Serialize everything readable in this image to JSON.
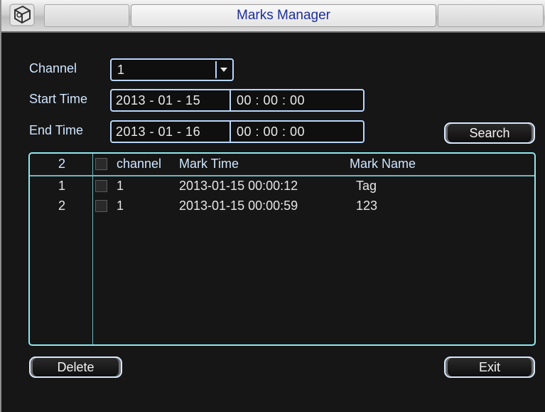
{
  "window": {
    "title": "Marks Manager"
  },
  "form": {
    "channel_label": "Channel",
    "channel_value": "1",
    "start_label": "Start Time",
    "start_date": "2013  - 01 - 15",
    "start_time": "00 : 00 : 00",
    "end_label": "End Time",
    "end_date": "2013  - 01 - 16",
    "end_time": "00 : 00 : 00",
    "search_label": "Search"
  },
  "table": {
    "count": "2",
    "headers": {
      "channel": "channel",
      "mark_time": "Mark Time",
      "mark_name": "Mark Name"
    },
    "rows": [
      {
        "index": "1",
        "channel": "1",
        "mark_time": "2013-01-15 00:00:12",
        "mark_name": "Tag"
      },
      {
        "index": "2",
        "channel": "1",
        "mark_time": "2013-01-15 00:00:59",
        "mark_name": "123"
      }
    ]
  },
  "footer": {
    "delete_label": "Delete",
    "exit_label": "Exit"
  },
  "colors": {
    "title_text": "#1c2f9c",
    "label_text": "#cfe6ff",
    "table_border": "#8ee8ee",
    "background": "#161616"
  },
  "icons": {
    "app": "app-logo-icon",
    "dropdown": "chevron-down-icon"
  }
}
